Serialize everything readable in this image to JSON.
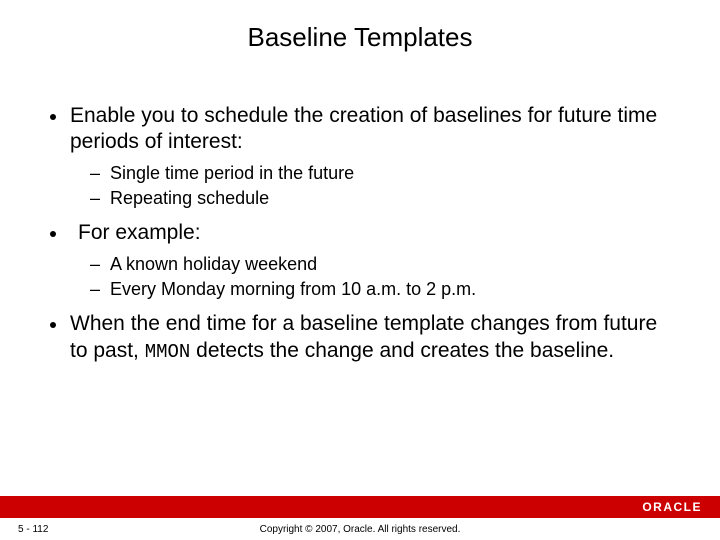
{
  "title": "Baseline Templates",
  "bullets": [
    {
      "text": "Enable you to schedule the creation of baselines for future time periods of interest:",
      "sub": [
        "Single time period in the future",
        "Repeating schedule"
      ]
    },
    {
      "text": "For example:",
      "sub": [
        "A known holiday weekend",
        "Every Monday morning from 10 a.m. to 2 p.m."
      ]
    },
    {
      "text_pre": "When the end time for a baseline template changes from future to past, ",
      "mono": "MMON",
      "text_post": " detects the change and creates the baseline.",
      "sub": []
    }
  ],
  "footer": {
    "page": "5 - 112",
    "copyright": "Copyright © 2007, Oracle. All rights reserved.",
    "logo": "ORACLE"
  }
}
